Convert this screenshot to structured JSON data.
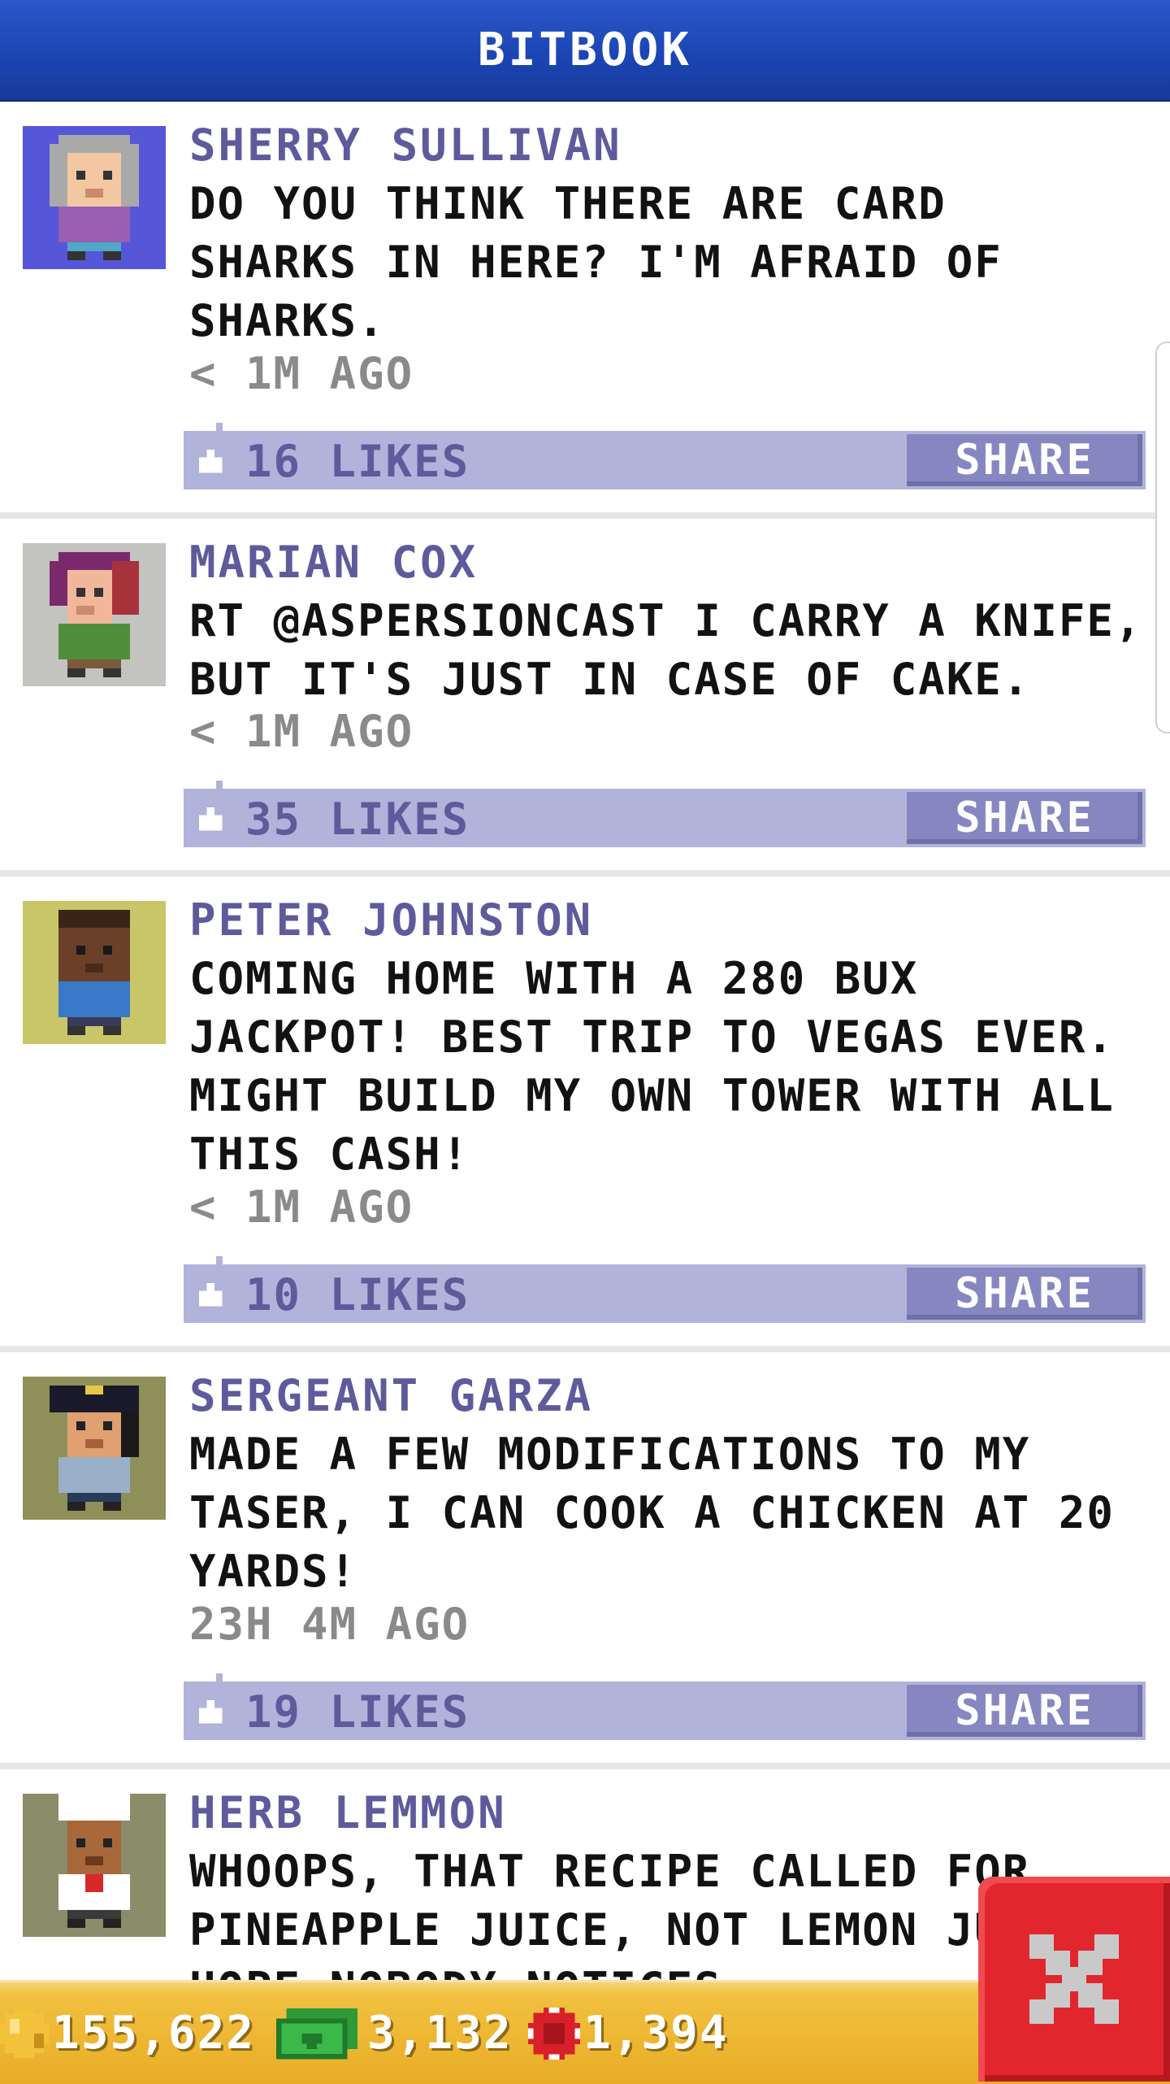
{
  "header": {
    "title": "BITBOOK"
  },
  "posts": [
    {
      "name": "SHERRY SULLIVAN",
      "lines": [
        "DO YOU THINK THERE ARE CARD",
        "SHARKS IN HERE? I'M AFRAID OF",
        "SHARKS."
      ],
      "time": "< 1M AGO",
      "likes": "16 LIKES",
      "share": "SHARE",
      "avatar_bg": "#5656d8"
    },
    {
      "name": "MARIAN COX",
      "lines": [
        "RT @ASPERSIONCAST I CARRY A KNIFE,",
        "BUT IT'S JUST IN CASE OF CAKE."
      ],
      "time": "< 1M AGO",
      "likes": "35 LIKES",
      "share": "SHARE",
      "avatar_bg": "#c3c3c0"
    },
    {
      "name": "PETER JOHNSTON",
      "lines": [
        "COMING HOME WITH A 280 BUX",
        "JACKPOT! BEST TRIP TO VEGAS EVER.",
        "MIGHT BUILD MY OWN TOWER WITH ALL",
        "THIS CASH!"
      ],
      "time": "< 1M AGO",
      "likes": "10 LIKES",
      "share": "SHARE",
      "avatar_bg": "#c9c66a"
    },
    {
      "name": "SERGEANT GARZA",
      "lines": [
        "MADE A FEW MODIFICATIONS TO MY",
        "TASER, I CAN COOK A CHICKEN AT 20",
        "YARDS!"
      ],
      "time": "23H 4M AGO",
      "likes": "19 LIKES",
      "share": "SHARE",
      "avatar_bg": "#8f8f5a"
    },
    {
      "name": "HERB LEMMON",
      "lines": [
        "WHOOPS, THAT RECIPE CALLED FOR",
        "PINEAPPLE JUICE, NOT LEMON JUICE.",
        "HOPE NOBODY NOTICES."
      ],
      "avatar_bg": "#8a8c6a"
    }
  ],
  "status_bar": {
    "coins": "155,622",
    "bux": "3,132",
    "chips": "1,394"
  },
  "colors": {
    "header_blue": "#1b44b2",
    "name_purple": "#5e5b9c",
    "like_bar": "#b2b3da",
    "share_button": "#8687c0",
    "status_gold": "#f1c13f",
    "close_red": "#e2262e"
  },
  "icons": {
    "close": "close-x-icon",
    "coin": "coin-icon",
    "bux": "bux-bill-icon",
    "chip": "poker-chip-icon",
    "like": "thumbs-up-icon"
  }
}
